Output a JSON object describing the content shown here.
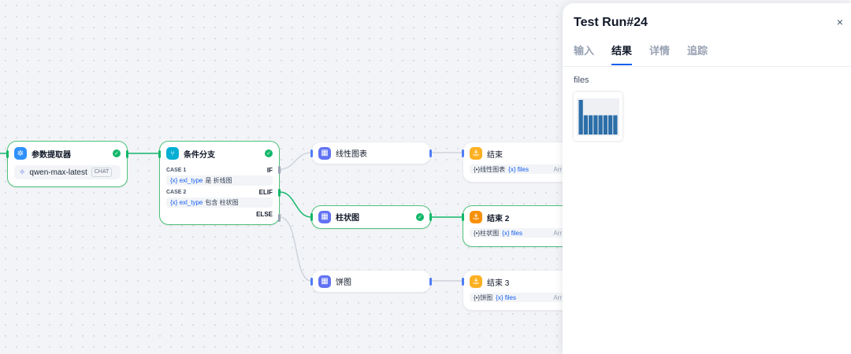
{
  "nodes": {
    "extractor": {
      "title": "参数提取器",
      "model": "qwen-max-latest",
      "model_tag": "CHAT",
      "icon": "parameter-extractor-icon"
    },
    "ifelse": {
      "title": "条件分支",
      "case1": {
        "label": "CASE 1",
        "keyword": "IF",
        "var": "{x}  exl_type",
        "cond": "是 折线图"
      },
      "case2": {
        "label": "CASE 2",
        "keyword": "ELIF",
        "var": "{x}  exl_type",
        "cond": "包含 柱状图"
      },
      "else_label": "ELSE"
    },
    "line_chart": {
      "title": "线性图表"
    },
    "bar_chart": {
      "title": "柱状图"
    },
    "pie_chart": {
      "title": "饼图"
    },
    "end1": {
      "title": "结束",
      "row_prefix": "{•}线性图表",
      "row_var": "{x} files",
      "row_type": "Arr"
    },
    "end2": {
      "title": "结束 2",
      "row_prefix": "{•}柱状图",
      "row_var": "{x} files",
      "row_type": "Arr"
    },
    "end3": {
      "title": "结束 3",
      "row_prefix": "{•}饼图",
      "row_var": "{x} files",
      "row_type": "Arr"
    }
  },
  "panel": {
    "title": "Test Run#24",
    "close": "×",
    "tabs": [
      "输入",
      "结果",
      "详情",
      "追踪"
    ],
    "active_tab": 1,
    "files_label": "files"
  },
  "thumbnail_chart": {
    "type": "bar",
    "values": [
      9,
      5,
      5,
      5,
      5,
      5,
      5,
      5
    ],
    "color": "#2b6ea8"
  },
  "colors": {
    "accent": "#155eef",
    "success": "#12b76a",
    "extractor_icon": "#2e90fa",
    "ifelse_icon": "#06aed4",
    "chart_icon": "#6172f3",
    "end_icon": "#f79009"
  }
}
